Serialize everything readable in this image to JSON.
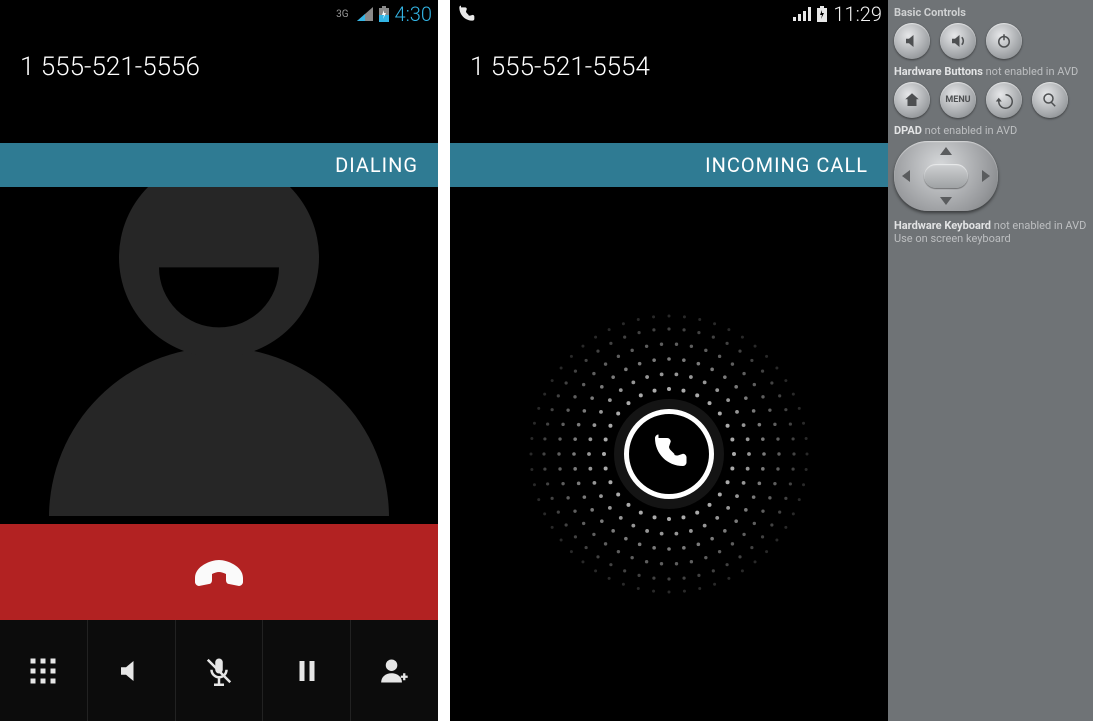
{
  "left": {
    "statusbar": {
      "net_label": "3G",
      "clock": "4:30"
    },
    "phone_number": "1 555-521-5556",
    "call_status": "DIALING",
    "actions": {
      "hangup": "End call",
      "dialpad": "Dialpad",
      "speaker": "Speaker",
      "mute": "Mute",
      "hold": "Hold",
      "add_call": "Add call"
    }
  },
  "right": {
    "statusbar": {
      "clock": "11:29"
    },
    "phone_number": "1 555-521-5554",
    "call_status": "INCOMING CALL",
    "answer_handle": "Answer / Decline"
  },
  "emu": {
    "sections": {
      "basic": "Basic Controls",
      "hw_buttons": "Hardware Buttons",
      "hw_buttons_note": "not enabled in AVD",
      "dpad": "DPAD",
      "dpad_note": "not enabled in AVD",
      "hw_kb": "Hardware Keyboard",
      "hw_kb_note": "not enabled in AVD",
      "hw_kb_hint": "Use on screen keyboard"
    },
    "buttons": {
      "vol_down": "Volume down",
      "vol_up": "Volume up",
      "power": "Power",
      "home": "Home",
      "menu_label": "MENU",
      "back": "Back",
      "search": "Search"
    }
  },
  "colors": {
    "accent": "#33b5e5",
    "strip": "#2f7b93",
    "hangup": "#b22222"
  }
}
